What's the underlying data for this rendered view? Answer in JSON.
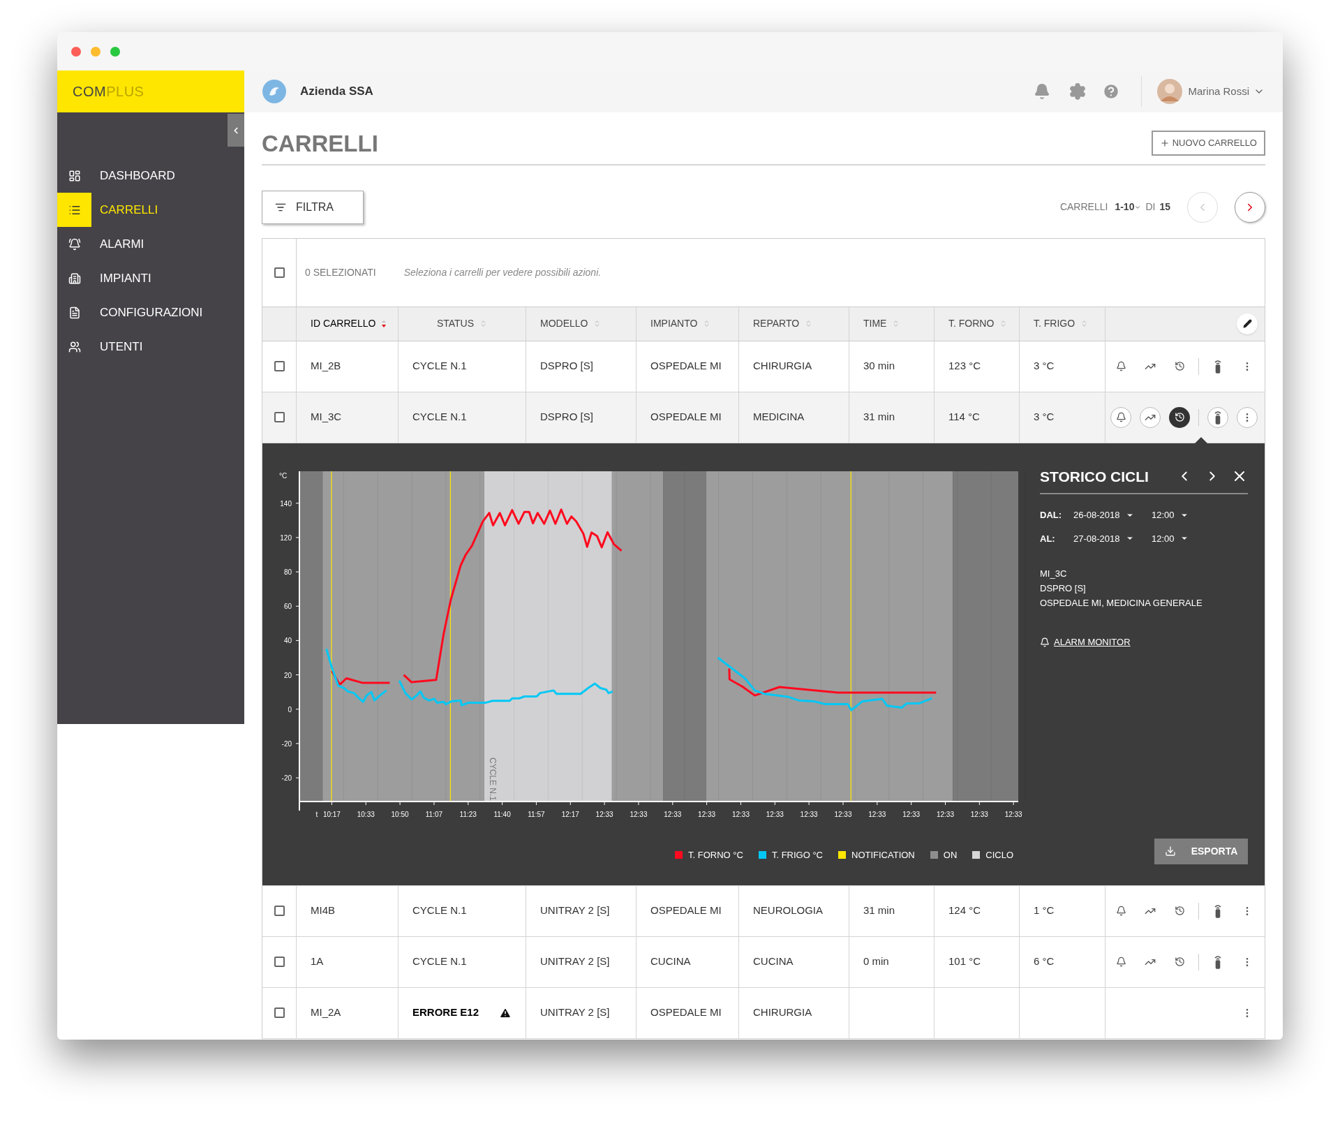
{
  "logo": {
    "primary": "COM",
    "secondary": "PLUS"
  },
  "sidebar": {
    "items": [
      {
        "label": "DASHBOARD",
        "selected": false
      },
      {
        "label": "CARRELLI",
        "selected": true
      },
      {
        "label": "ALARMI",
        "selected": false
      },
      {
        "label": "IMPIANTI",
        "selected": false
      },
      {
        "label": "CONFIGURAZIONI",
        "selected": false
      },
      {
        "label": "UTENTI",
        "selected": false
      }
    ]
  },
  "header": {
    "organization": "Azienda SSA",
    "user": "Marina Rossi"
  },
  "page": {
    "title": "CARRELLI",
    "new_button": "NUOVO CARRELLO",
    "filter_button": "FILTRA"
  },
  "pagination": {
    "label": "CARRELLI",
    "range": "1-10",
    "of": "DI",
    "total": "15",
    "prev_disabled": true,
    "next_disabled": false
  },
  "selection": {
    "checked": false,
    "count": "0 SELEZIONATI",
    "hint": "Seleziona i carrelli per vedere possibili azioni."
  },
  "table": {
    "columns": [
      {
        "label": "ID CARRELLO",
        "sorted": true
      },
      {
        "label": "STATUS",
        "sorted": false
      },
      {
        "label": "MODELLO",
        "sorted": false
      },
      {
        "label": "IMPIANTO",
        "sorted": false
      },
      {
        "label": "REPARTO",
        "sorted": false
      },
      {
        "label": "TIME",
        "sorted": false
      },
      {
        "label": "T. FORNO",
        "sorted": false
      },
      {
        "label": "T. FRIGO",
        "sorted": false
      }
    ],
    "rows": [
      {
        "checked": false,
        "expanded": false,
        "kind": "cycle",
        "cells": [
          "MI_2B",
          "CYCLE N.1",
          "DSPRO [S]",
          "OSPEDALE MI",
          "CHIRURGIA",
          "30 min",
          "123 °C",
          "3 °C"
        ]
      },
      {
        "checked": false,
        "expanded": true,
        "kind": "cycle",
        "cells": [
          "MI_3C",
          "CYCLE N.1",
          "DSPRO [S]",
          "OSPEDALE MI",
          "MEDICINA",
          "31 min",
          "114 °C",
          "3 °C"
        ]
      },
      {
        "checked": false,
        "expanded": false,
        "kind": "cycle",
        "cells": [
          "MI4B",
          "CYCLE N.1",
          "UNITRAY 2 [S]",
          "OSPEDALE MI",
          "NEUROLOGIA",
          "31 min",
          "124 °C",
          "1 °C"
        ]
      },
      {
        "checked": false,
        "expanded": false,
        "kind": "cycle",
        "cells": [
          "1A",
          "CYCLE N.1",
          "UNITRAY 2 [S]",
          "CUCINA",
          "CUCINA",
          "0 min",
          "101 °C",
          "6 °C"
        ]
      },
      {
        "checked": false,
        "expanded": false,
        "kind": "error",
        "cells": [
          "MI_2A",
          "ERRORE E12",
          "UNITRAY 2 [S]",
          "OSPEDALE MI",
          "CHIRURGIA"
        ]
      }
    ]
  },
  "history_panel": {
    "title": "STORICO CICLI",
    "from_label": "DAL:",
    "from_date": "26-08-2018",
    "from_time": "12:00",
    "to_label": "AL:",
    "to_date": "27-08-2018",
    "to_time": "12:00",
    "info": [
      "MI_3C",
      "DSPRO [S]",
      "OSPEDALE MI, MEDICINA GENERALE"
    ],
    "alarm_link": "ALARM MONITOR",
    "export_button": "ESPORTA",
    "chart": {
      "y_unit": "°C",
      "y_labels": [
        "140",
        "120",
        "80",
        "60",
        "40",
        "20",
        "0",
        "-20",
        "-20"
      ],
      "x_prefix": "t",
      "x_labels": [
        "10:17",
        "10:33",
        "10:50",
        "11:07",
        "11:23",
        "11:40",
        "11:57",
        "12:17",
        "12:33",
        "12:33",
        "12:33",
        "12:33",
        "12:33",
        "12:33",
        "12:33",
        "12:33",
        "12:33",
        "12:33",
        "12:33",
        "12:33",
        "12:33"
      ],
      "band_label": "CYCLE N.1"
    },
    "legend": [
      {
        "label": "T. FORNO °C",
        "color": "#ff0a1e"
      },
      {
        "label": "T. FRIGO °C",
        "color": "#00c8f5"
      },
      {
        "label": "NOTIFICATION",
        "color": "#ffe600"
      },
      {
        "label": "ON",
        "color": "#8e8e8e"
      },
      {
        "label": "CICLO",
        "color": "#d6d6d6"
      }
    ]
  }
}
